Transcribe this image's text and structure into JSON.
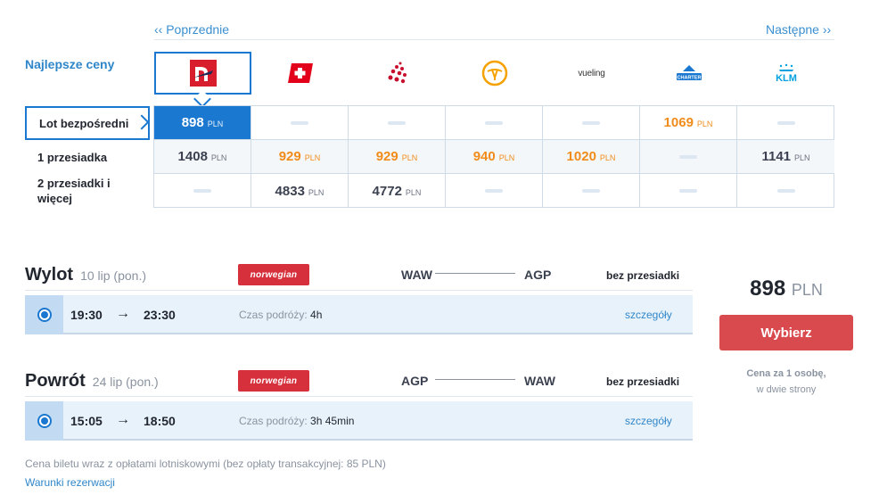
{
  "nav": {
    "prev": "‹‹ Poprzednie",
    "next": "Następne ››"
  },
  "best_label": "Najlepsze ceny",
  "airlines": [
    {
      "name": "norwegian-logo-icon",
      "color": "#d81e2d"
    },
    {
      "name": "swiss-logo-icon",
      "color": "#e2001a"
    },
    {
      "name": "brussels-logo-icon",
      "color": "#c8102e"
    },
    {
      "name": "lufthansa-logo-icon",
      "color": "#f5a200"
    },
    {
      "name": "vueling-logo-icon",
      "text": "vueling"
    },
    {
      "name": "charter-logo-icon",
      "text": "CHARTER"
    },
    {
      "name": "klm-logo-icon",
      "text": "KLM"
    }
  ],
  "rows": [
    {
      "label": "Lot bezpośredni"
    },
    {
      "label": "1 przesiadka"
    },
    {
      "label": "2 przesiadki i więcej"
    }
  ],
  "grid": [
    [
      {
        "v": "898",
        "c": "PLN"
      },
      {
        "v": null
      },
      {
        "v": null
      },
      {
        "v": null
      },
      {
        "v": null
      },
      {
        "v": "1069",
        "c": "PLN"
      },
      {
        "v": null
      }
    ],
    [
      {
        "v": "1408",
        "c": "PLN"
      },
      {
        "v": "929",
        "c": "PLN"
      },
      {
        "v": "929",
        "c": "PLN"
      },
      {
        "v": "940",
        "c": "PLN"
      },
      {
        "v": "1020",
        "c": "PLN"
      },
      {
        "v": null
      },
      {
        "v": "1141",
        "c": "PLN"
      }
    ],
    [
      {
        "v": null
      },
      {
        "v": "4833",
        "c": "PLN"
      },
      {
        "v": "4772",
        "c": "PLN"
      },
      {
        "v": null
      },
      {
        "v": null
      },
      {
        "v": null
      },
      {
        "v": null
      }
    ]
  ],
  "outbound": {
    "title": "Wylot",
    "date": "10 lip (pon.)",
    "airline": "norwegian",
    "from": "WAW",
    "to": "AGP",
    "stops": "bez przesiadki",
    "dep": "19:30",
    "arr": "23:30",
    "duration_label": "Czas podróży:",
    "duration": "4h",
    "details": "szczegóły"
  },
  "inbound": {
    "title": "Powrót",
    "date": "24 lip (pon.)",
    "airline": "norwegian",
    "from": "AGP",
    "to": "WAW",
    "stops": "bez przesiadki",
    "dep": "15:05",
    "arr": "18:50",
    "duration_label": "Czas podróży:",
    "duration": "3h 45min",
    "details": "szczegóły"
  },
  "price": {
    "amount": "898",
    "currency": "PLN",
    "button": "Wybierz",
    "note1": "Cena za 1 osobę,",
    "note2": "w dwie strony"
  },
  "footer": {
    "note": "Cena biletu wraz z opłatami lotniskowymi (bez opłaty transakcyjnej: 85 PLN)",
    "link": "Warunki rezerwacji"
  },
  "colors": {
    "accent": "#1b78d0",
    "orange": "#f08c1b",
    "button": "#d94a4f",
    "brand_red": "#d6303c"
  }
}
